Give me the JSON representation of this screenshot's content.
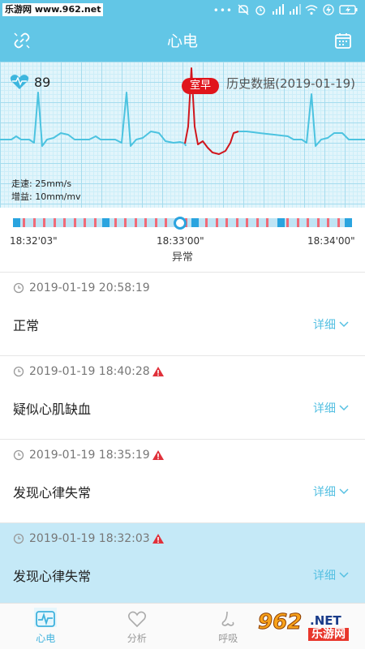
{
  "status_bar": {
    "watermark": "乐游网 www.962.net",
    "icons": [
      "dots-icon",
      "mute-icon",
      "alarm-icon",
      "hd-signal-icon",
      "signal-icon",
      "wifi-icon",
      "charging-icon",
      "battery-icon"
    ]
  },
  "header": {
    "title": "心电",
    "left_icon": "link-icon",
    "right_icon": "calendar-icon"
  },
  "ecg": {
    "heart_rate": "89",
    "badge": "室早",
    "history_label": "历史数据(2019-01-19)",
    "speed": "走速: 25mm/s",
    "gain": "增益: 10mm/mv",
    "colors": {
      "normal": "#4cc3e0",
      "abnormal": "#d0161d"
    }
  },
  "timeline": {
    "start": "18:32'03\"",
    "mid": "18:33'00\"",
    "end": "18:34'00\"",
    "under_label": "异常",
    "position": 0.49
  },
  "records": [
    {
      "time": "2019-01-19 20:58:19",
      "label": "正常",
      "warning": false,
      "detail": "详细",
      "selected": false
    },
    {
      "time": "2019-01-19 18:40:28",
      "label": "疑似心肌缺血",
      "warning": true,
      "detail": "详细",
      "selected": false
    },
    {
      "time": "2019-01-19 18:35:19",
      "label": "发现心律失常",
      "warning": true,
      "detail": "详细",
      "selected": false
    },
    {
      "time": "2019-01-19 18:32:03",
      "label": "发现心律失常",
      "warning": true,
      "detail": "详细",
      "selected": true
    }
  ],
  "bottom_nav": [
    {
      "label": "心电",
      "icon": "ecg-icon",
      "active": true
    },
    {
      "label": "分析",
      "icon": "heart-outline-icon",
      "active": false
    },
    {
      "label": "呼吸",
      "icon": "nose-icon",
      "active": false
    },
    {
      "label": "",
      "icon": "more-icon",
      "active": false
    }
  ],
  "site_logo": {
    "text_main": "962",
    "text_net": ".NET",
    "text_cn": "乐游网"
  }
}
